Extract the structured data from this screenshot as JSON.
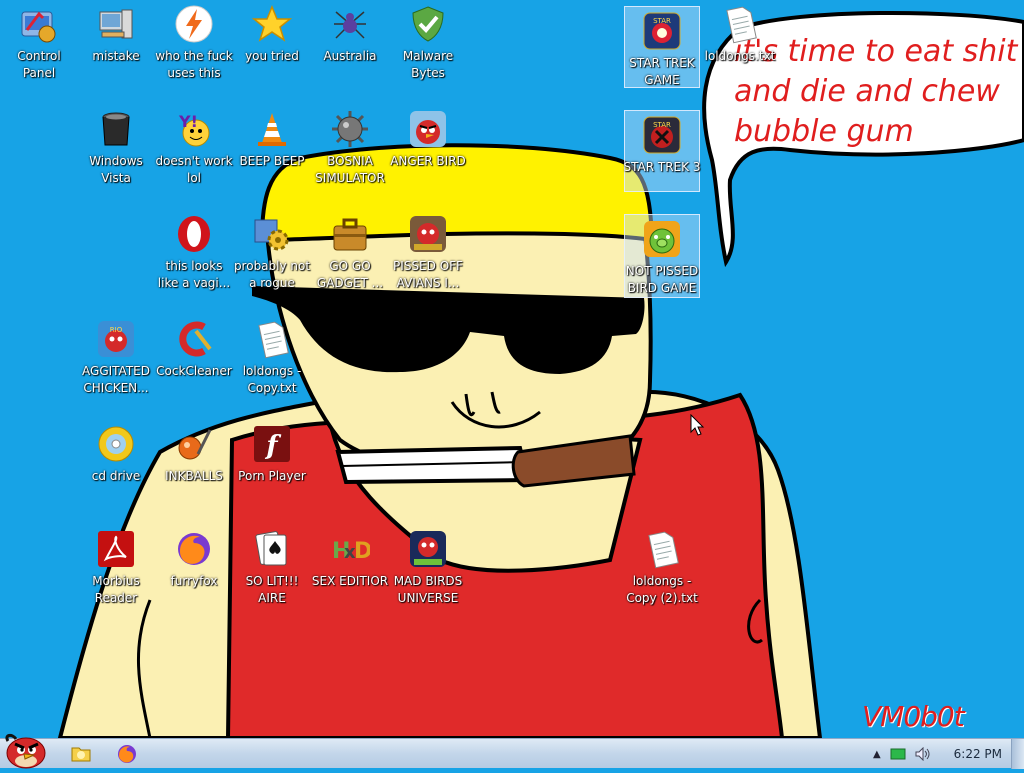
{
  "wallpaper": {
    "speech": "it's time to eat shit and die and chew bubble gum",
    "signature": "VM0b0t"
  },
  "icons": [
    {
      "name": "icon-control-panel",
      "label": "Control Panel",
      "glyph": "control-panel-icon"
    },
    {
      "name": "icon-mistake",
      "label": "mistake",
      "glyph": "computer-icon"
    },
    {
      "name": "icon-who-the-fuck-uses-this",
      "label": "who the fuck uses this",
      "glyph": "lightning-icon"
    },
    {
      "name": "icon-you-tried",
      "label": "you tried",
      "glyph": "star-icon"
    },
    {
      "name": "icon-australia",
      "label": "Australia",
      "glyph": "spider-icon"
    },
    {
      "name": "icon-malware-bytes",
      "label": "Malware Bytes",
      "glyph": "shield-icon"
    },
    {
      "name": "icon-star-trek-game",
      "label": "STAR TREK GAME",
      "glyph": "star-wars-game-icon"
    },
    {
      "name": "icon-loldongs-txt",
      "label": "loldongs.txt",
      "glyph": "text-file-icon"
    },
    {
      "name": "icon-windows-vista",
      "label": "Windows Vista",
      "glyph": "trash-can-icon"
    },
    {
      "name": "icon-doesnt-work-lol",
      "label": "doesn't work lol",
      "glyph": "yahoo-icon"
    },
    {
      "name": "icon-beep-beep",
      "label": "BEEP BEEP",
      "glyph": "traffic-cone-icon"
    },
    {
      "name": "icon-bosnia-simulator",
      "label": "BOSNIA SIMULATOR",
      "glyph": "mine-icon"
    },
    {
      "name": "icon-anger-bird",
      "label": "ANGER BIRD",
      "glyph": "angry-bird-icon"
    },
    {
      "name": "icon-star-trek-3",
      "label": "STAR TREK 3",
      "glyph": "star-wars-game-icon"
    },
    {
      "name": "icon-opera",
      "label": "this looks like a vagi...",
      "glyph": "opera-icon"
    },
    {
      "name": "icon-probably-not-a-rogue",
      "label": "probably not a rogue",
      "glyph": "gear-icon"
    },
    {
      "name": "icon-go-go-gadget",
      "label": "GO GO GADGET ...",
      "glyph": "briefcase-icon"
    },
    {
      "name": "icon-pissed-off-avians",
      "label": "PISSED OFF AVIANS I...",
      "glyph": "angry-bird-seasons-icon"
    },
    {
      "name": "icon-not-pissed-bird-game",
      "label": "NOT PISSED BIRD GAME",
      "glyph": "green-pig-icon"
    },
    {
      "name": "icon-aggitated-chicken",
      "label": "AGGITATED CHICKEN...",
      "glyph": "angry-bird-rio-icon"
    },
    {
      "name": "icon-cockcleaner",
      "label": "CockCleaner",
      "glyph": "ccleaner-icon"
    },
    {
      "name": "icon-loldongs-copy",
      "label": "loldongs - Copy.txt",
      "glyph": "text-file-icon"
    },
    {
      "name": "icon-cd-drive",
      "label": "cd drive",
      "glyph": "cd-icon"
    },
    {
      "name": "icon-inkballs",
      "label": "INKBALLS",
      "glyph": "inkball-icon"
    },
    {
      "name": "icon-porn-player",
      "label": "Porn Player",
      "glyph": "flash-icon"
    },
    {
      "name": "icon-morbius-reader",
      "label": "Morbius Reader",
      "glyph": "pdf-reader-icon"
    },
    {
      "name": "icon-furryfox",
      "label": "furryfox",
      "glyph": "firefox-icon"
    },
    {
      "name": "icon-so-lit-aire",
      "label": "SO LIT!!! AIRE",
      "glyph": "solitaire-icon"
    },
    {
      "name": "icon-sex-editior",
      "label": "SEX EDITIOR",
      "glyph": "hex-editor-icon"
    },
    {
      "name": "icon-mad-birds-universe",
      "label": "MAD BIRDS UNIVERSE",
      "glyph": "angry-bird-space-icon"
    },
    {
      "name": "icon-loldongs-copy-2",
      "label": "loldongs - Copy (2).txt",
      "glyph": "text-file-icon"
    }
  ],
  "taskbar": {
    "start_glyph": "angry-bird-icon",
    "pinned": [
      {
        "name": "taskbar-explorer",
        "glyph": "folder-icon"
      },
      {
        "name": "taskbar-firefox",
        "glyph": "firefox-icon"
      }
    ],
    "tray": {
      "clock": "6:22 PM"
    }
  },
  "colors": {
    "desktop": "#17a3e6",
    "shirt": "#e02a2a",
    "skin": "#fbf0b3",
    "hair": "#fff200",
    "text_red": "#e01e1e"
  }
}
